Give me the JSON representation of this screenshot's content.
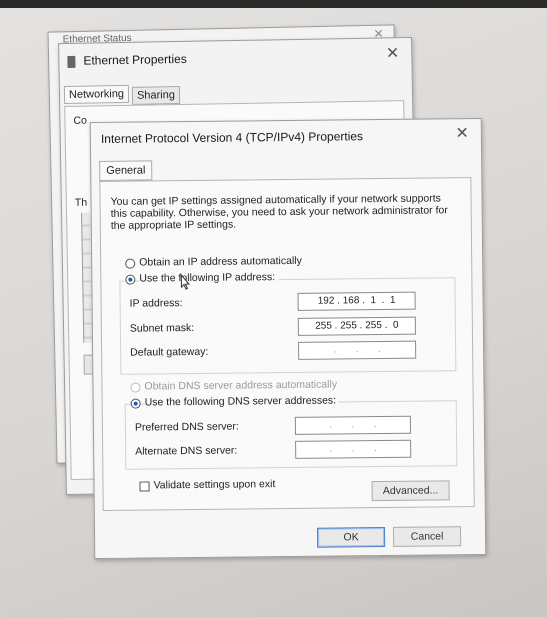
{
  "back_window": {
    "title": "Ethernet Status",
    "close": "✕"
  },
  "ethernet_props": {
    "title": "Ethernet Properties",
    "close": "✕",
    "tabs": [
      "Networking",
      "Sharing"
    ],
    "partial_labels": [
      "Co",
      "Th"
    ]
  },
  "ipv4_dialog": {
    "title": "Internet Protocol Version 4 (TCP/IPv4) Properties",
    "close": "✕",
    "tab": "General",
    "description": "You can get IP settings assigned automatically if your network supports this capability. Otherwise, you need to ask your network administrator for the appropriate IP settings.",
    "radio_auto_ip": "Obtain an IP address automatically",
    "radio_manual_ip": "Use the following IP address:",
    "ip_label": "IP address:",
    "ip_value": "192 . 168 .  1  .  1",
    "subnet_label": "Subnet mask:",
    "subnet_value": "255 . 255 . 255 .  0",
    "gateway_label": "Default gateway:",
    "gateway_value": ".       .       .",
    "radio_auto_dns": "Obtain DNS server address automatically",
    "radio_manual_dns": "Use the following DNS server addresses:",
    "preferred_dns_label": "Preferred DNS server:",
    "preferred_dns_value": ".       .       .",
    "alternate_dns_label": "Alternate DNS server:",
    "alternate_dns_value": ".       .       .",
    "validate_label": "Validate settings upon exit",
    "advanced_label": "Advanced...",
    "ok_label": "OK",
    "cancel_label": "Cancel"
  }
}
